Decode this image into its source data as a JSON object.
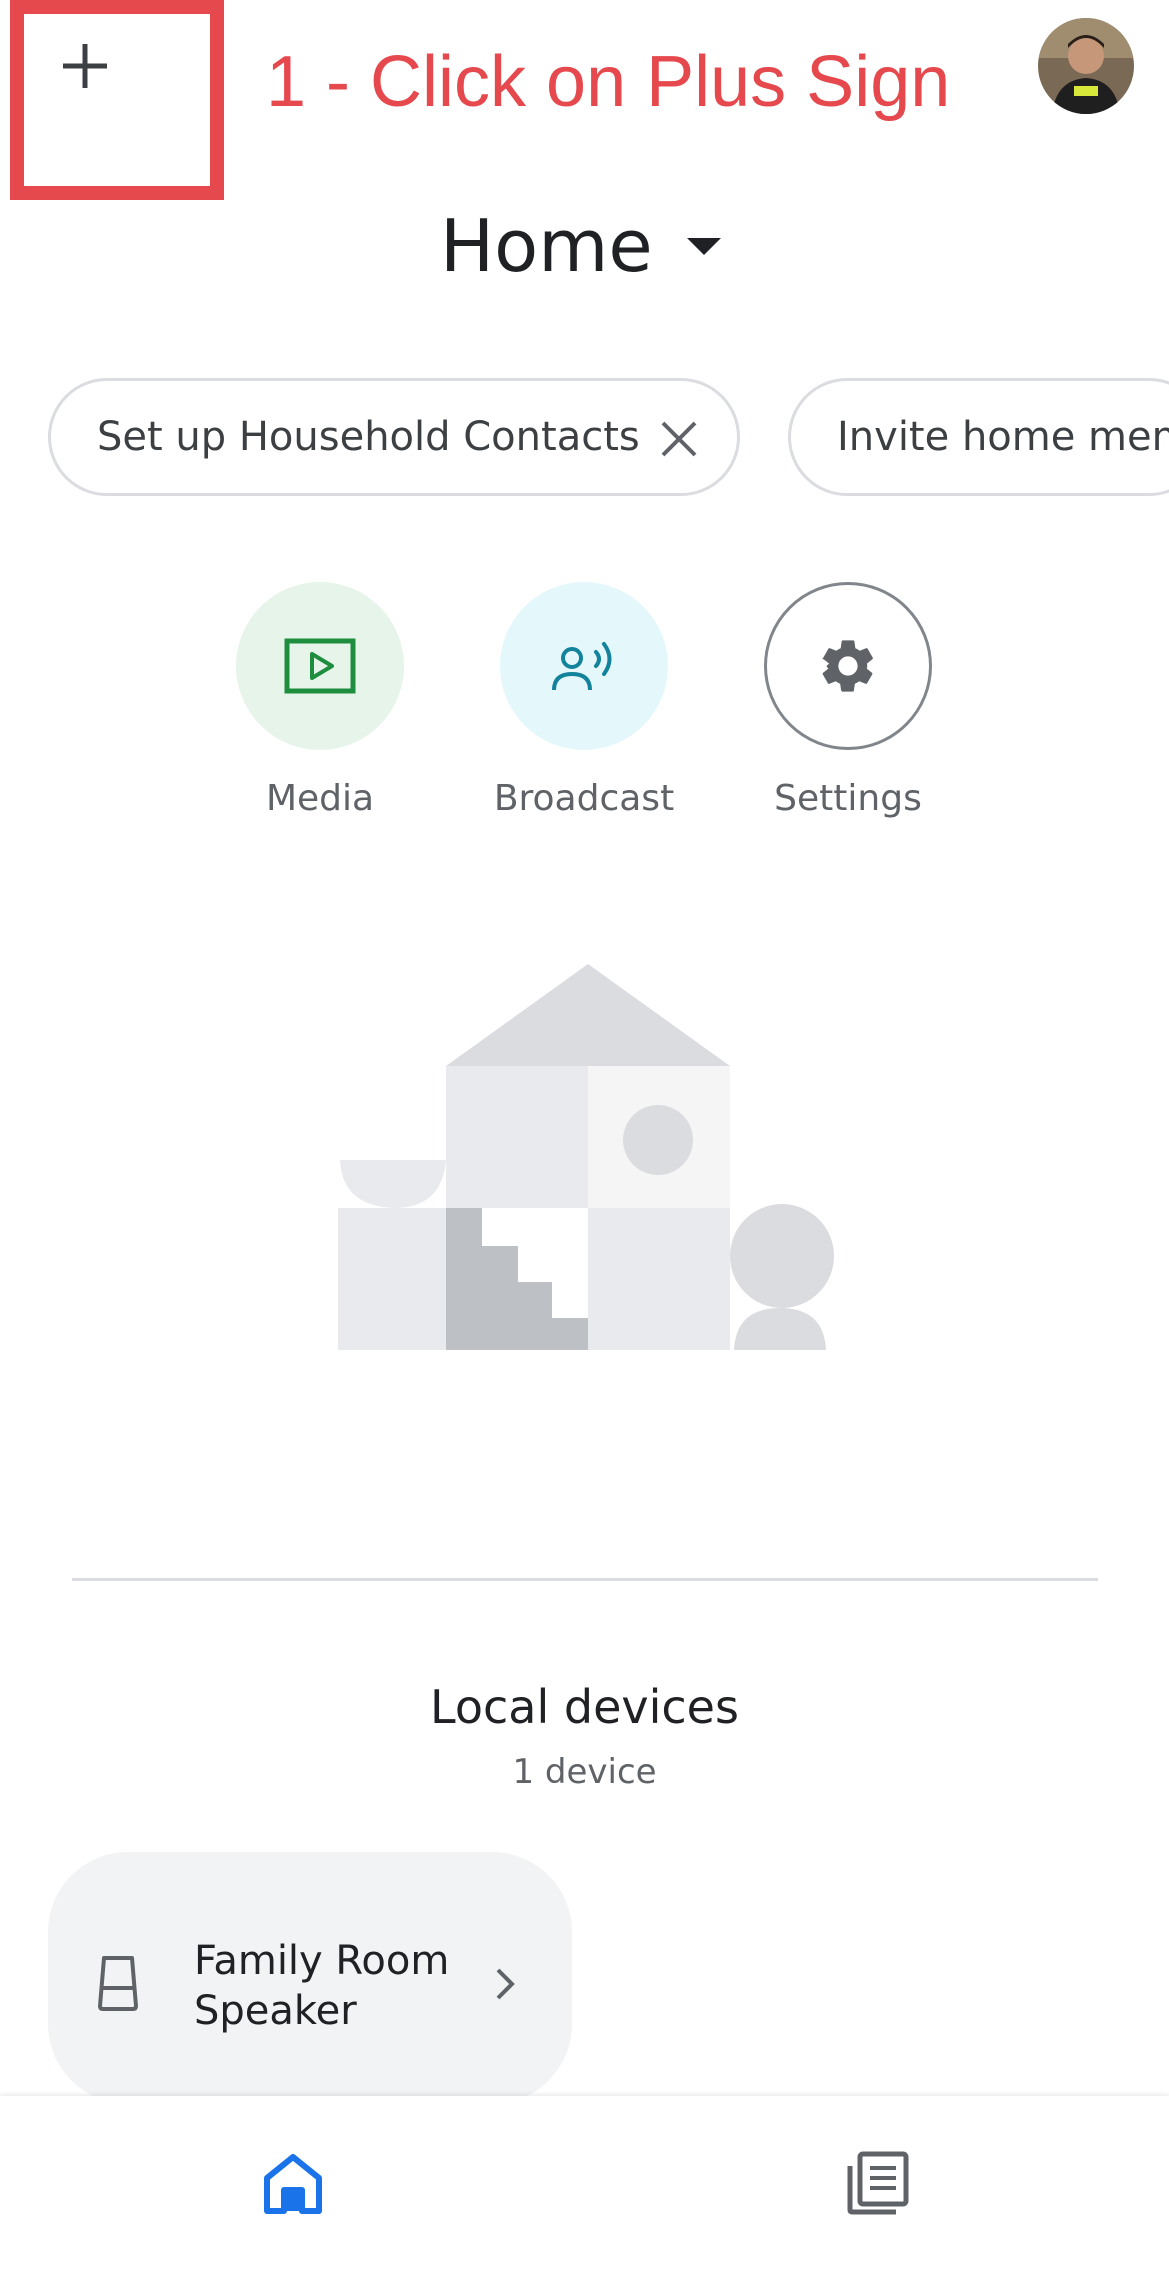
{
  "annotation": {
    "text": "1 - Click on Plus Sign",
    "color": "#e5484d"
  },
  "toolbar": {
    "add_icon": "plus-icon",
    "avatar": "user-avatar"
  },
  "header": {
    "home_name": "Home"
  },
  "chips": [
    {
      "label": "Set up Household Contacts",
      "icon": "close-icon"
    },
    {
      "label": "Invite home mem"
    }
  ],
  "actions": [
    {
      "label": "Media",
      "icon": "media-play-icon",
      "bg": "#e6f4ea",
      "fg": "#1e8e3e"
    },
    {
      "label": "Broadcast",
      "icon": "broadcast-icon",
      "bg": "#e4f7fb",
      "fg": "#12839b"
    },
    {
      "label": "Settings",
      "icon": "gear-icon",
      "bg": "#ffffff",
      "fg": "#5f6368"
    }
  ],
  "local_devices": {
    "title": "Local devices",
    "count": "1 device",
    "devices": [
      {
        "name": "Family Room Speaker",
        "icon": "speaker-icon"
      }
    ]
  },
  "bottom_nav": [
    {
      "icon": "home-icon",
      "active": true,
      "color": "#1a73e8"
    },
    {
      "icon": "feed-icon",
      "active": false,
      "color": "#5f6368"
    }
  ]
}
